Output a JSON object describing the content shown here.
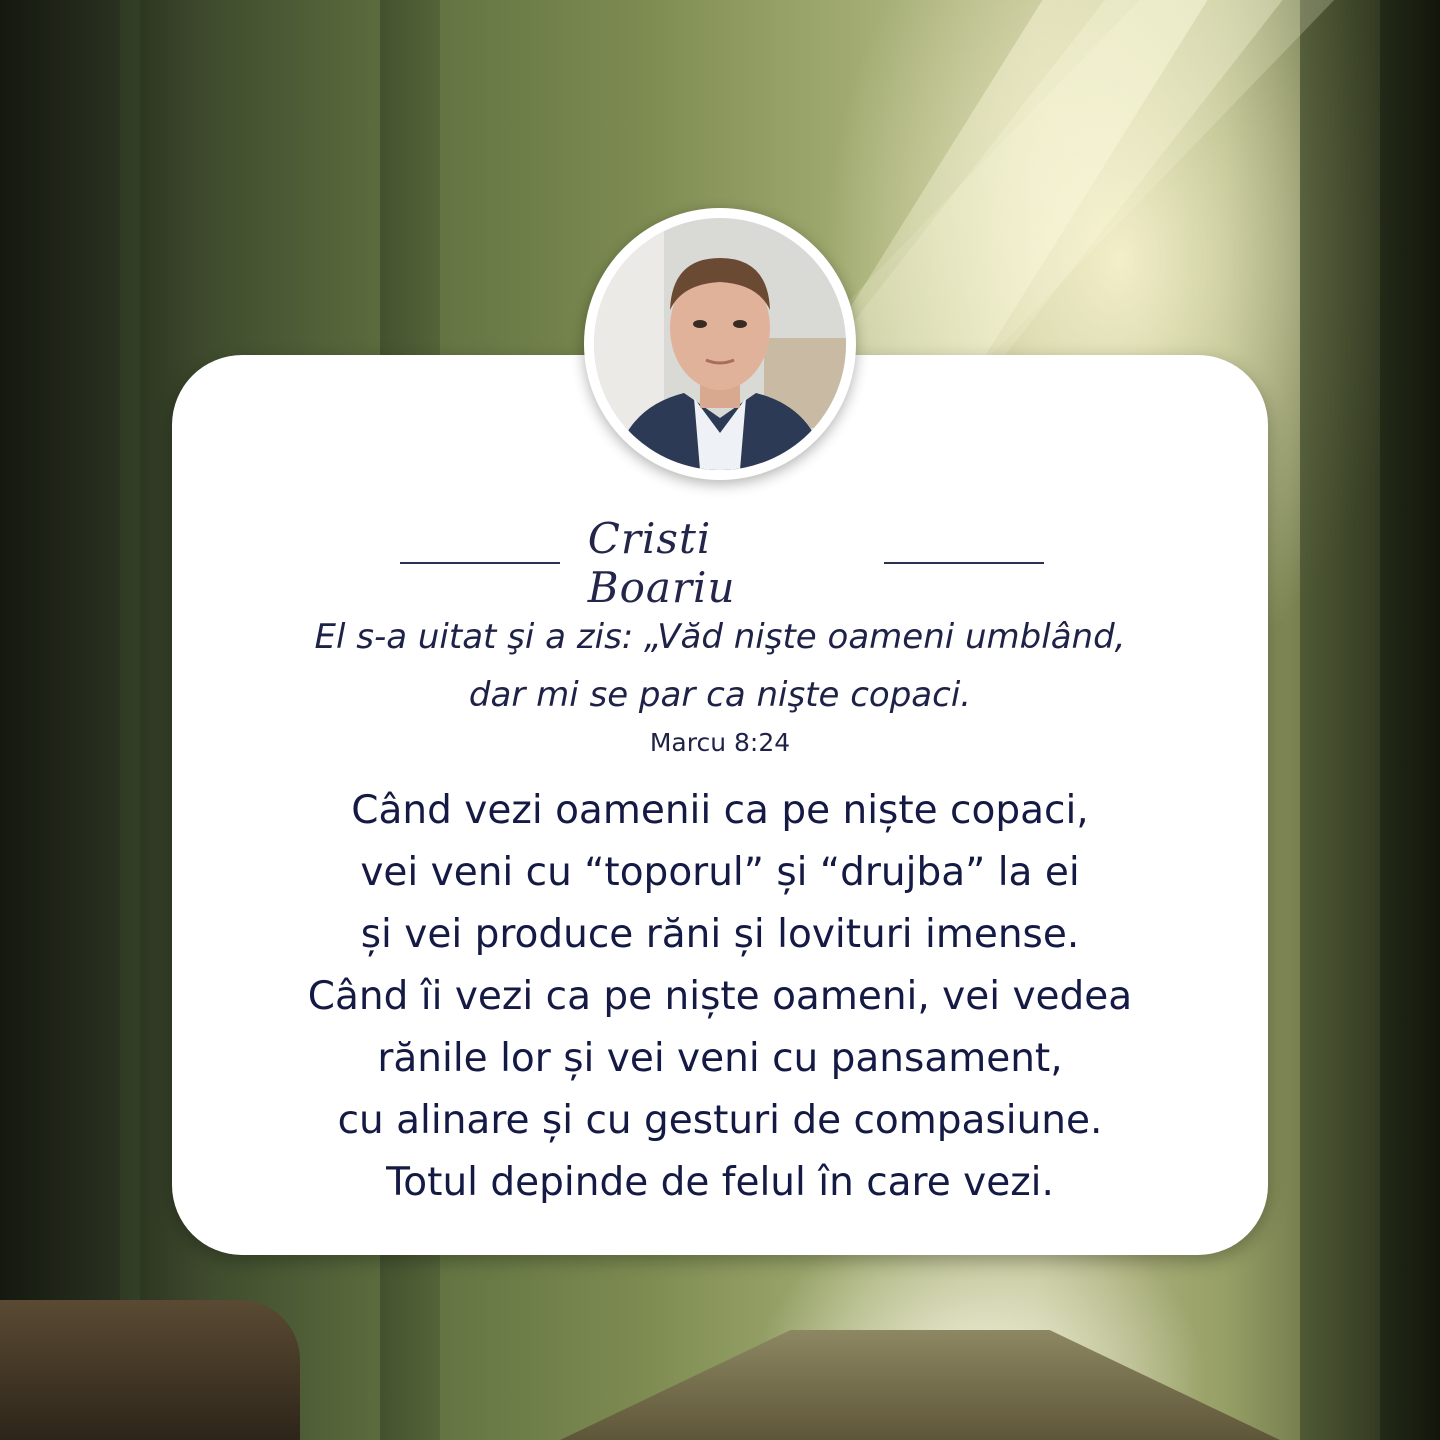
{
  "author": {
    "name": "Cristi Boariu"
  },
  "verse": {
    "lines": [
      "El s-a uitat şi a zis: „Văd nişte oameni umblând,",
      "dar mi se par ca nişte copaci."
    ],
    "reference": "Marcu 8:24"
  },
  "message": {
    "lines": [
      "Când vezi oamenii ca pe niște copaci,",
      "vei veni cu “toporul” și “drujba” la ei",
      "și vei produce răni și lovituri imense.",
      "Când îi vezi ca pe niște oameni, vei vedea",
      "rănile lor și vei veni cu pansament,",
      "cu alinare și cu gesturi de compasiune.",
      "Totul depinde de felul în care vezi."
    ]
  },
  "colors": {
    "text": "#151a45",
    "card": "#ffffff",
    "forest": "#5f7040"
  },
  "icons": {
    "avatar": "person-portrait"
  }
}
